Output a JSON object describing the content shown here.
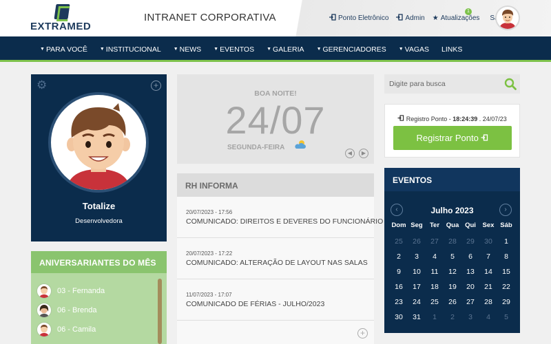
{
  "header": {
    "logo_text": "EXTRAMED",
    "page_title": "INTRANET CORPORATIVA",
    "links": [
      {
        "label": "Ponto Eletrônico",
        "icon": "signin-icon"
      },
      {
        "label": "Admin",
        "icon": "signin-icon"
      },
      {
        "label": "Atualizações",
        "icon": "star-icon"
      },
      {
        "label": "Sair",
        "icon": ""
      }
    ],
    "updates_badge": "1"
  },
  "nav": {
    "items": [
      "PARA VOCÊ",
      "INSTITUCIONAL",
      "NEWS",
      "EVENTOS",
      "GALERIA",
      "GERENCIADORES",
      "VAGAS",
      "LINKS"
    ]
  },
  "profile": {
    "name": "Totalize",
    "role": "Desenvolvedora"
  },
  "birthdays": {
    "title": "ANIVERSARIANTES DO MÊS",
    "items": [
      "03 - Fernanda",
      "06 - Brenda",
      "06 - Camila"
    ]
  },
  "date_card": {
    "greeting": "BOA NOITE!",
    "date": "24/07",
    "weekday": "SEGUNDA-FEIRA"
  },
  "rh": {
    "title": "RH INFORMA",
    "items": [
      {
        "date": "20/07/2023 - 17:56",
        "title": "COMUNICADO: DIREITOS E DEVERES DO FUNCIONÁRIO"
      },
      {
        "date": "20/07/2023 - 17:22",
        "title": "COMUNICADO: ALTERAÇÃO DE LAYOUT NAS SALAS"
      },
      {
        "date": "11/07/2023 - 17:07",
        "title": "COMUNICADO DE FÉRIAS - JULHO/2023"
      }
    ]
  },
  "search": {
    "placeholder": "Digite para busca"
  },
  "ponto": {
    "label": "Registro Ponto - ",
    "time": "18:24:39",
    "date": " . 24/07/23",
    "button": "Registrar Ponto"
  },
  "events": {
    "title": "EVENTOS",
    "month": "Julho 2023",
    "weekdays": [
      "Dom",
      "Seg",
      "Ter",
      "Qua",
      "Qui",
      "Sex",
      "Sáb"
    ],
    "days": [
      {
        "d": "25",
        "m": true
      },
      {
        "d": "26",
        "m": true
      },
      {
        "d": "27",
        "m": true
      },
      {
        "d": "28",
        "m": true
      },
      {
        "d": "29",
        "m": true
      },
      {
        "d": "30",
        "m": true
      },
      {
        "d": "1",
        "m": false
      },
      {
        "d": "2",
        "m": false
      },
      {
        "d": "3",
        "m": false
      },
      {
        "d": "4",
        "m": false
      },
      {
        "d": "5",
        "m": false
      },
      {
        "d": "6",
        "m": false
      },
      {
        "d": "7",
        "m": false
      },
      {
        "d": "8",
        "m": false
      },
      {
        "d": "9",
        "m": false
      },
      {
        "d": "10",
        "m": false
      },
      {
        "d": "11",
        "m": false
      },
      {
        "d": "12",
        "m": false
      },
      {
        "d": "13",
        "m": false
      },
      {
        "d": "14",
        "m": false
      },
      {
        "d": "15",
        "m": false
      },
      {
        "d": "16",
        "m": false
      },
      {
        "d": "17",
        "m": false
      },
      {
        "d": "18",
        "m": false
      },
      {
        "d": "19",
        "m": false
      },
      {
        "d": "20",
        "m": false
      },
      {
        "d": "21",
        "m": false
      },
      {
        "d": "22",
        "m": false
      },
      {
        "d": "23",
        "m": false
      },
      {
        "d": "24",
        "m": false
      },
      {
        "d": "25",
        "m": false
      },
      {
        "d": "26",
        "m": false
      },
      {
        "d": "27",
        "m": false
      },
      {
        "d": "28",
        "m": false
      },
      {
        "d": "29",
        "m": false
      },
      {
        "d": "30",
        "m": false
      },
      {
        "d": "31",
        "m": false
      },
      {
        "d": "1",
        "m": true
      },
      {
        "d": "2",
        "m": true
      },
      {
        "d": "3",
        "m": true
      },
      {
        "d": "4",
        "m": true
      },
      {
        "d": "5",
        "m": true
      }
    ]
  },
  "colors": {
    "navy": "#0b2c4c",
    "accent_green": "#7cc142",
    "bday_green": "#8ac46e"
  }
}
